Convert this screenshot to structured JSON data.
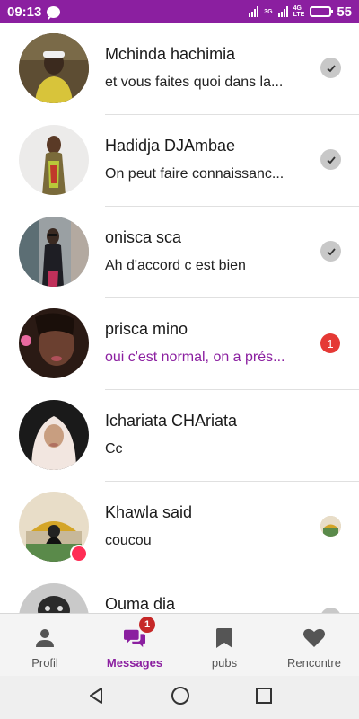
{
  "status_bar": {
    "time": "09:13",
    "network_labels": [
      "3G",
      "4G",
      "4G",
      "LTE"
    ],
    "battery_level": "55",
    "battery_fraction": 0.55
  },
  "conversations": [
    {
      "name": "Mchinda hachimia",
      "preview": "et vous faites quoi dans la...",
      "status": "read"
    },
    {
      "name": "Hadidja DJAmbae",
      "preview": "On peut faire connaissanc...",
      "status": "read"
    },
    {
      "name": "onisca sca",
      "preview": "Ah d'accord c est bien",
      "status": "read"
    },
    {
      "name": "prisca mino",
      "preview": "oui c'est normal, on a prés...",
      "status": "unread",
      "unread_count": "1"
    },
    {
      "name": "Ichariata CHAriata",
      "preview": "Cc",
      "status": "none"
    },
    {
      "name": "Khawla said",
      "preview": "coucou",
      "status": "seen"
    },
    {
      "name": "Ouma dia",
      "preview": "",
      "status": "read"
    }
  ],
  "bottom_nav": {
    "items": [
      {
        "label": "Profil",
        "icon": "person-icon"
      },
      {
        "label": "Messages",
        "icon": "chat-bubbles-icon",
        "badge": "1",
        "active": true
      },
      {
        "label": "pubs",
        "icon": "bookmark-icon"
      },
      {
        "label": "Rencontre",
        "icon": "heart-icon"
      }
    ]
  },
  "colors": {
    "brand": "#8b1fa0",
    "unread_badge": "#e53935",
    "nav_badge": "#c62828"
  }
}
